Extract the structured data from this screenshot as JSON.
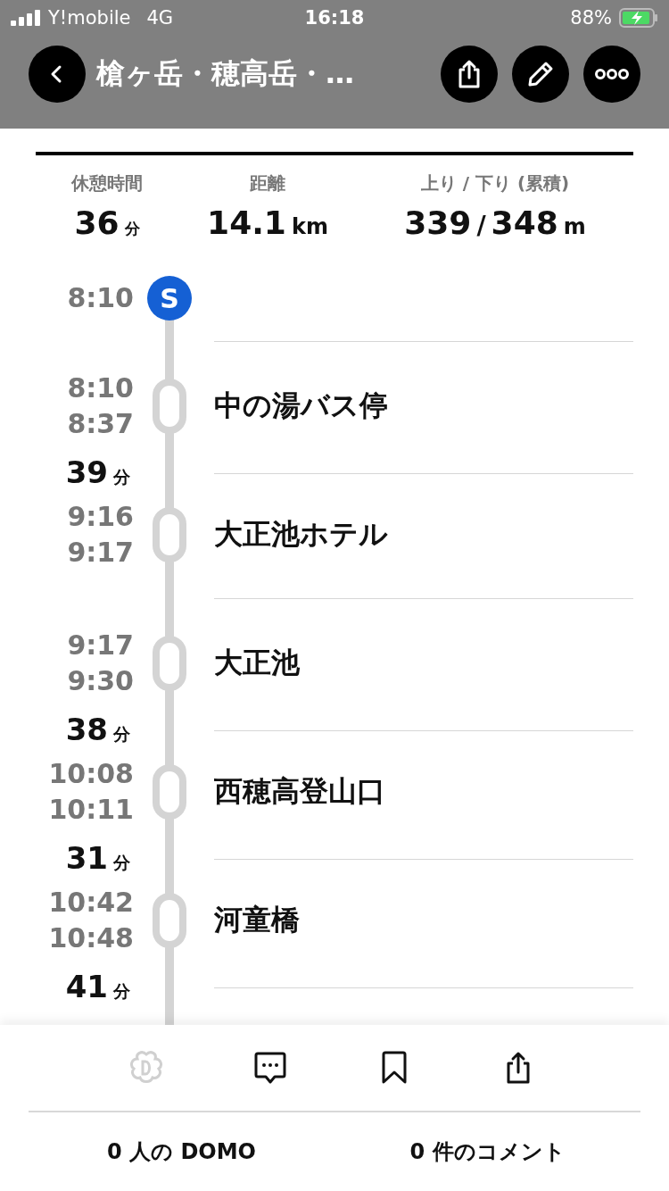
{
  "status_bar": {
    "carrier": "Y!mobile",
    "network": "4G",
    "time": "16:18",
    "battery": "88%"
  },
  "header": {
    "title": "槍ヶ岳・穂高岳・…"
  },
  "stats": [
    {
      "label": "休憩時間",
      "parts": [
        {
          "text": "36",
          "kind": "num"
        },
        {
          "text": "分",
          "kind": "unit"
        }
      ]
    },
    {
      "label": "距離",
      "parts": [
        {
          "text": "14.1",
          "kind": "num"
        },
        {
          "text": "km",
          "kind": "unit"
        }
      ]
    },
    {
      "label": "上り / 下り (累積)",
      "parts": [
        {
          "text": "339",
          "kind": "num"
        },
        {
          "text": "/",
          "kind": "sep"
        },
        {
          "text": "348",
          "kind": "num"
        },
        {
          "text": "m",
          "kind": "unit"
        }
      ]
    }
  ],
  "start": {
    "time": "8:10",
    "badge": "S"
  },
  "timeline": [
    {
      "kind": "leg"
    },
    {
      "kind": "stop",
      "arrive": "8:10",
      "depart": "8:37",
      "name": "中の湯バス停"
    },
    {
      "kind": "leg",
      "duration": "39",
      "unit": "分"
    },
    {
      "kind": "stop",
      "arrive": "9:16",
      "depart": "9:17",
      "name": "大正池ホテル"
    },
    {
      "kind": "leg"
    },
    {
      "kind": "stop",
      "arrive": "9:17",
      "depart": "9:30",
      "name": "大正池"
    },
    {
      "kind": "leg",
      "duration": "38",
      "unit": "分"
    },
    {
      "kind": "stop",
      "arrive": "10:08",
      "depart": "10:11",
      "name": "西穂高登山口"
    },
    {
      "kind": "leg",
      "duration": "31",
      "unit": "分"
    },
    {
      "kind": "stop",
      "arrive": "10:42",
      "depart": "10:48",
      "name": "河童橋"
    },
    {
      "kind": "leg",
      "duration": "41",
      "unit": "分"
    }
  ],
  "footer": {
    "domo": "0 人の DOMO",
    "comments": "0 件のコメント"
  }
}
